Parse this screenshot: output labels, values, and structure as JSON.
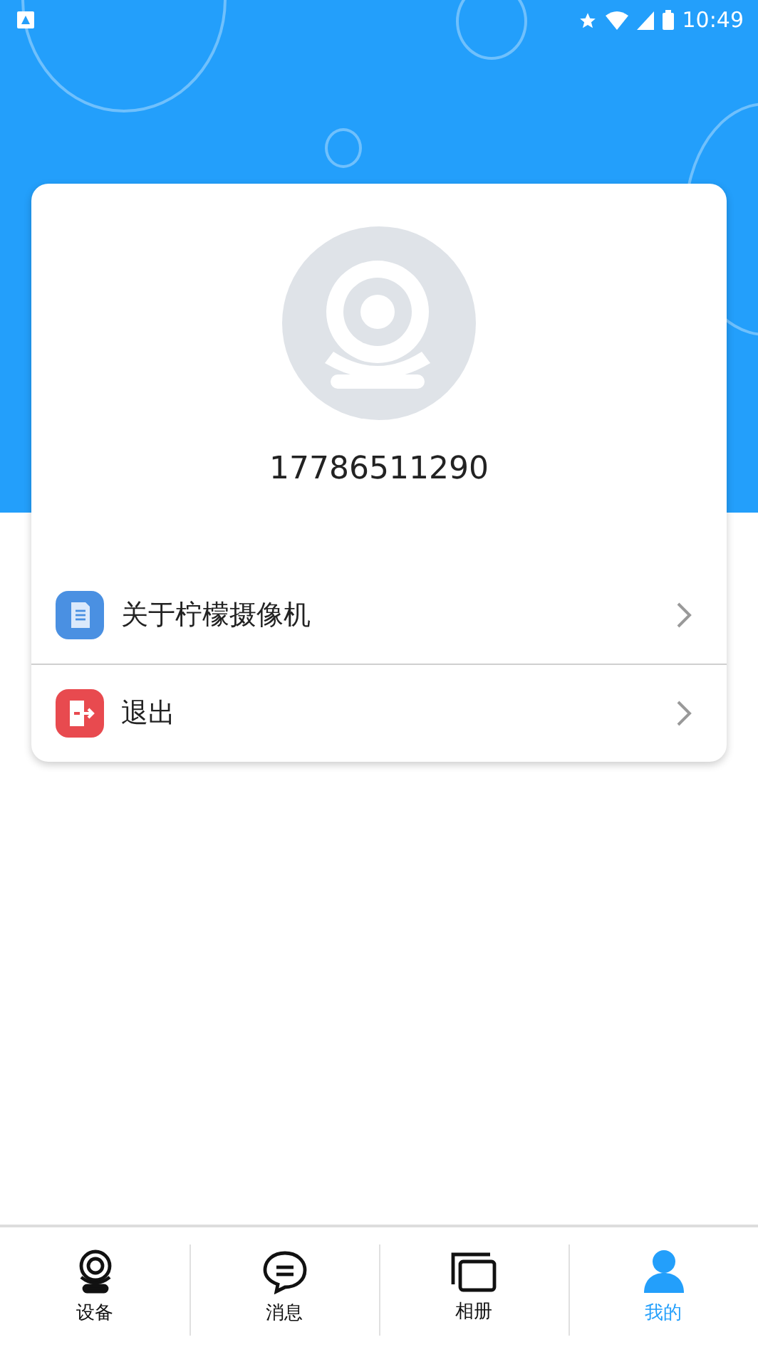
{
  "status_bar": {
    "time": "10:49"
  },
  "profile": {
    "phone": "17786511290"
  },
  "menu": [
    {
      "kind": "about",
      "label": "关于柠檬摄像机"
    },
    {
      "kind": "logout",
      "label": "退出"
    }
  ],
  "tabs": [
    {
      "kind": "device",
      "label": "设备",
      "selected": false
    },
    {
      "kind": "message",
      "label": "消息",
      "selected": false
    },
    {
      "kind": "album",
      "label": "相册",
      "selected": false
    },
    {
      "kind": "me",
      "label": "我的",
      "selected": true
    }
  ]
}
